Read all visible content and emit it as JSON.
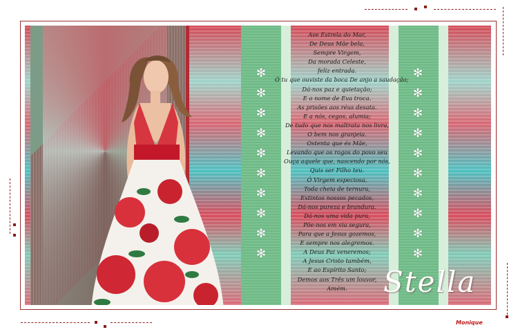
{
  "artwork": {
    "poem_lines": [
      "Ave Estrela do Mar,",
      "De Deus Mãe bela,",
      "Sempre Virgem,",
      "Da morada Celeste,",
      "feliz entrada.",
      "Ó tu que ouviste da boca De anjo a saudação;",
      "Dá-nos paz e quietação;",
      "E o nome de Eva troca.",
      "As prisões aos réus desata.",
      "E a nós, cegos, alumia;",
      "De tudo que nos maltrata nos livra,",
      "O bem nos granjeia.",
      "Ostenta que és Mãe,",
      "Levando que os rogos do povo seu",
      "Ouça aquele que, nascendo por nós,",
      "Quis ser Filho teu.",
      "Ó Virgem especiosa,",
      "Toda cheia de ternura,",
      "Extintos nossos pecados,",
      "Dá-nos pureza e brandura.",
      "Dá-nos uma vida pura,",
      "Põe-nos em via segura,",
      "Para que a Jesus gozemos,",
      "E sempre nos alegremos.",
      "A Deus Pai veneremos;",
      "A Jesus Cristo também,",
      "E ao Espírito Santo;",
      "Demos aos Três um louvor,",
      "Amém."
    ],
    "signature": "Stella",
    "credit": "Monique",
    "flower_icon": "eight-petal-flower-icon"
  },
  "colors": {
    "frame": "#9a2c2c",
    "accent_red": "#b22a34",
    "stripe_green": "#7cc392",
    "dots": "#8b1d1d",
    "credit": "#c01818"
  }
}
